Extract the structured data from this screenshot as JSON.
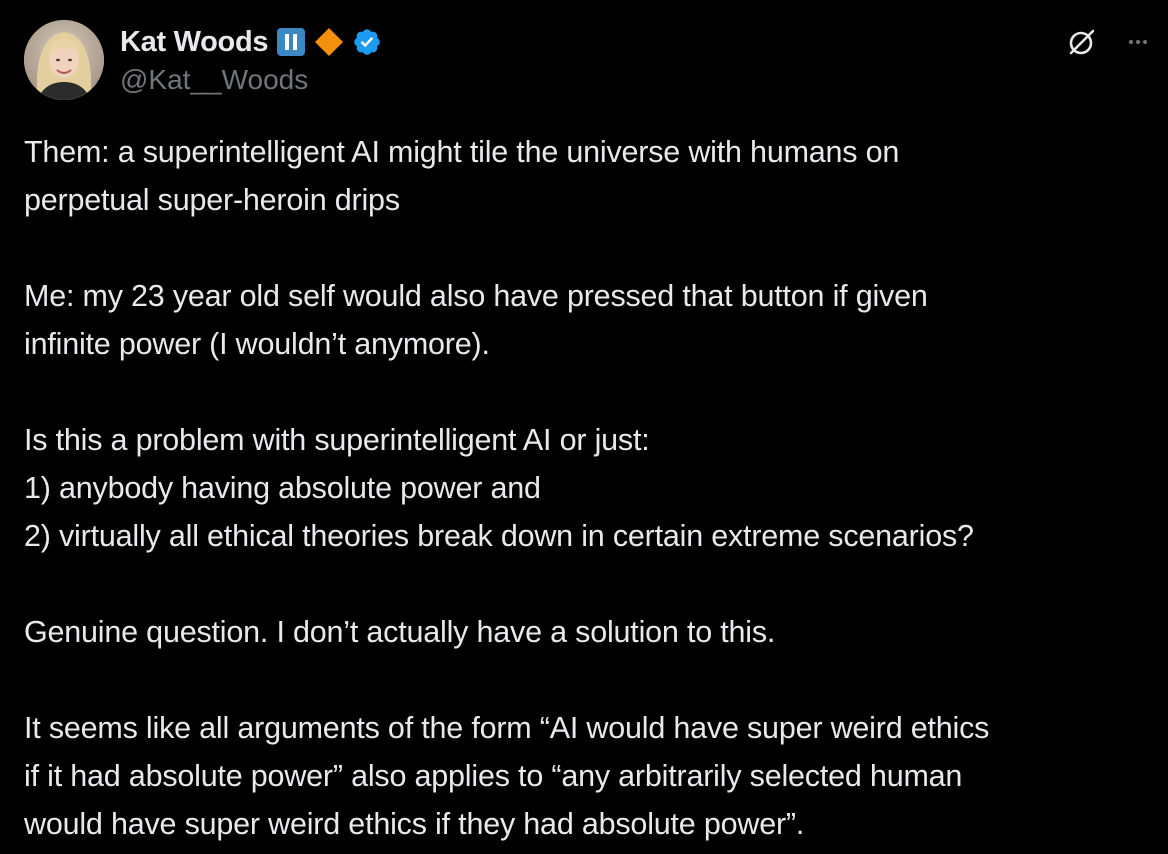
{
  "author": {
    "display_name": "Kat Woods",
    "handle": "@Kat__Woods",
    "avatar_icon": "avatar-photo",
    "badges": [
      {
        "icon": "pause-badge-icon",
        "color": "#3b88c3"
      },
      {
        "icon": "orange-diamond-icon",
        "color": "#f4900c"
      },
      {
        "icon": "verified-badge-icon",
        "color": "#1d9bf0"
      }
    ]
  },
  "header_actions": {
    "grok_icon": "grok-icon",
    "more_icon": "more-options-icon"
  },
  "tweet": {
    "paragraphs": [
      "Them: a superintelligent AI might tile the universe with humans on\nperpetual super-heroin drips",
      "Me: my 23 year old self would also have pressed that button if given\ninfinite power (I wouldn’t anymore).",
      "Is this a problem with superintelligent AI or just:\n1) anybody having absolute power and\n2) virtually all ethical theories break down in certain extreme scenarios?",
      "Genuine question. I don’t actually have a solution to this.",
      "It seems like all arguments of the form “AI would have super weird ethics\nif it had absolute power” also applies to “any arbitrarily selected human\nwould have super weird ethics if they had absolute power”."
    ]
  },
  "colors": {
    "background": "#000000",
    "text_primary": "#e7e9ea",
    "text_secondary": "#71767b",
    "verified_blue": "#1d9bf0"
  }
}
